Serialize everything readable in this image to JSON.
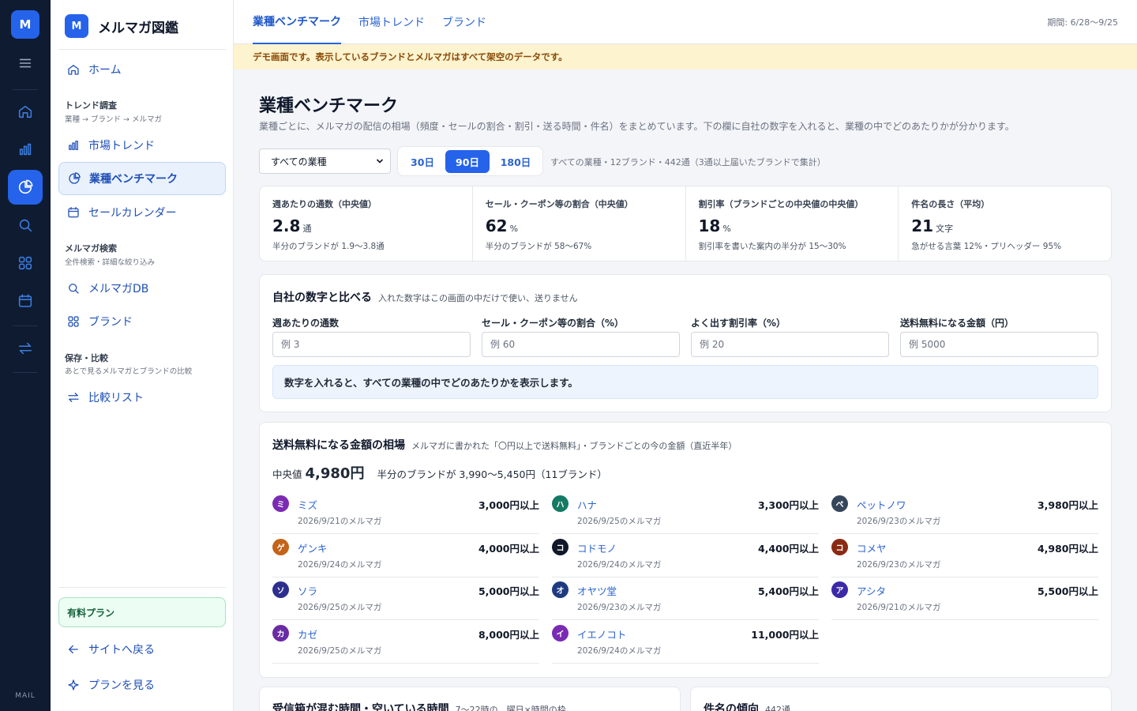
{
  "rail": {
    "logo": "M",
    "footer": "MAIL"
  },
  "sidebar": {
    "logo": "M",
    "app_name": "メルマガ図鑑",
    "home": "ホーム",
    "sections": [
      {
        "title": "トレンド調査",
        "sub": "業種 → ブランド → メルマガ"
      },
      {
        "title": "メルマガ検索",
        "sub": "全件検索・詳細な絞り込み"
      },
      {
        "title": "保存・比較",
        "sub": "あとで見るメルマガとブランドの比較"
      }
    ],
    "items": {
      "market_trend": "市場トレンド",
      "benchmark": "業種ベンチマーク",
      "sale_calendar": "セールカレンダー",
      "mail_db": "メルマガDB",
      "brand": "ブランド",
      "compare_list": "比較リスト"
    },
    "plan": "有料プラン",
    "back_to_site": "サイトへ戻る",
    "view_plans": "プランを見る"
  },
  "topbar": {
    "tabs": [
      "業種ベンチマーク",
      "市場トレンド",
      "ブランド"
    ],
    "period": "期間: 6/28〜9/25"
  },
  "banner": "デモ画面です。表示しているブランドとメルマガはすべて架空のデータです。",
  "page": {
    "title": "業種ベンチマーク",
    "description": "業種ごとに、メルマガの配信の相場（頻度・セールの割合・割引・送る時間・件名）をまとめています。下の欄に自社の数字を入れると、業種の中でどのあたりかが分かります。"
  },
  "filters": {
    "industry": "すべての業種",
    "ranges": [
      "30日",
      "90日",
      "180日"
    ],
    "active_range": "90日",
    "summary": "すべての業種・12ブランド・442通（3通以上届いたブランドで集計）"
  },
  "stats": [
    {
      "label": "週あたりの通数（中央値）",
      "value": "2.8",
      "unit": "通",
      "note": "半分のブランドが 1.9〜3.8通"
    },
    {
      "label": "セール・クーポン等の割合（中央値）",
      "value": "62",
      "unit": "%",
      "note": "半分のブランドが 58〜67%"
    },
    {
      "label": "割引率（ブランドごとの中央値の中央値）",
      "value": "18",
      "unit": "%",
      "note": "割引率を書いた案内の半分が 15〜30%"
    },
    {
      "label": "件名の長さ（平均）",
      "value": "21",
      "unit": "文字",
      "note": "急がせる言葉 12%・プリヘッダー 95%"
    }
  ],
  "compare": {
    "title": "自社の数字と比べる",
    "subtitle": "入れた数字はこの画面の中だけで使い、送りません",
    "fields": [
      {
        "label": "週あたりの通数",
        "placeholder": "例 3"
      },
      {
        "label": "セール・クーポン等の割合（%）",
        "placeholder": "例 60"
      },
      {
        "label": "よく出す割引率（%）",
        "placeholder": "例 20"
      },
      {
        "label": "送料無料になる金額（円）",
        "placeholder": "例 5000"
      }
    ],
    "hint": "数字を入れると、すべての業種の中でどのあたりかを表示します。"
  },
  "shipping": {
    "title": "送料無料になる金額の相場",
    "subtitle": "メルマガに書かれた「〇円以上で送料無料」・ブランドごとの今の金額（直近半年）",
    "median_label": "中央値",
    "median_value": "4,980円",
    "range": "半分のブランドが 3,990〜5,450円（11ブランド）",
    "items": [
      {
        "badge": "ミ",
        "color": "#7a2bb3",
        "name": "ミズ",
        "date": "2026/9/21のメルマガ",
        "price": "3,000円以上"
      },
      {
        "badge": "ハ",
        "color": "#147a63",
        "name": "ハナ",
        "date": "2026/9/25のメルマガ",
        "price": "3,300円以上"
      },
      {
        "badge": "ペ",
        "color": "#36465a",
        "name": "ペットノワ",
        "date": "2026/9/23のメルマガ",
        "price": "3,980円以上"
      },
      {
        "badge": "ゲ",
        "color": "#c4631a",
        "name": "ゲンキ",
        "date": "2026/9/24のメルマガ",
        "price": "4,000円以上"
      },
      {
        "badge": "コ",
        "color": "#111827",
        "name": "コドモノ",
        "date": "2026/9/24のメルマガ",
        "price": "4,400円以上"
      },
      {
        "badge": "コ",
        "color": "#8a2a12",
        "name": "コメヤ",
        "date": "2026/9/23のメルマガ",
        "price": "4,980円以上"
      },
      {
        "badge": "ソ",
        "color": "#2e2e8f",
        "name": "ソラ",
        "date": "2026/9/25のメルマガ",
        "price": "5,000円以上"
      },
      {
        "badge": "オ",
        "color": "#1e3a80",
        "name": "オヤツ堂",
        "date": "2026/9/23のメルマガ",
        "price": "5,400円以上"
      },
      {
        "badge": "ア",
        "color": "#3b2aa8",
        "name": "アシタ",
        "date": "2026/9/21のメルマガ",
        "price": "5,500円以上"
      },
      {
        "badge": "カ",
        "color": "#6a2ba3",
        "name": "カゼ",
        "date": "2026/9/25のメルマガ",
        "price": "8,000円以上"
      },
      {
        "badge": "イ",
        "color": "#7a2bb3",
        "name": "イエノコト",
        "date": "2026/9/24のメルマガ",
        "price": "11,000円以上"
      }
    ]
  },
  "bottom_cards": {
    "left_title": "受信箱が混む時間・空いている時間",
    "left_subtitle": "7〜22時の、曜日×時間の枠",
    "right_title": "件名の傾向",
    "right_subtitle": "442通"
  }
}
